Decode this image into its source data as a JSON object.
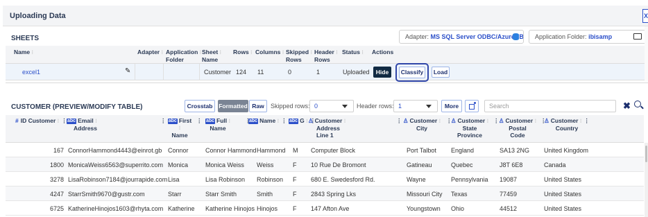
{
  "window": {
    "title": "Uploading Data",
    "close_label": "X"
  },
  "sheets": {
    "title": "SHEETS",
    "adapter": {
      "label": "Adapter:",
      "value": "MS SQL Server ODBC/AzureDB -..."
    },
    "app_folder": {
      "label": "Application Folder:",
      "value": "ibisamp"
    },
    "columns": [
      {
        "l1": "Name",
        "l2": ""
      },
      {
        "l1": "Adapter",
        "l2": ""
      },
      {
        "l1": "Application",
        "l2": "Folder"
      },
      {
        "l1": "Sheet",
        "l2": "Name"
      },
      {
        "l1": "Rows",
        "l2": ""
      },
      {
        "l1": "Columns",
        "l2": ""
      },
      {
        "l1": "Skipped",
        "l2": "Rows"
      },
      {
        "l1": "Header",
        "l2": "Rows"
      },
      {
        "l1": "Status",
        "l2": ""
      },
      {
        "l1": "Actions",
        "l2": ""
      }
    ],
    "row": {
      "name": "excel1",
      "sheet_name": "Customer",
      "rows": "124",
      "columns": "11",
      "skipped_rows": "0",
      "header_rows": "1",
      "status": "Uploaded",
      "actions": {
        "hide": "Hide",
        "classify": "Classify",
        "load": "Load"
      }
    }
  },
  "preview": {
    "title": "CUSTOMER (PREVIEW/MODIFY TABLE)",
    "buttons": {
      "crosstab": "Crosstab",
      "formatted": "Formatted",
      "raw": "Raw",
      "more": "More"
    },
    "skipped_rows": {
      "label": "Skipped rows:",
      "value": "0"
    },
    "header_rows": {
      "label": "Header rows:",
      "value": "1"
    },
    "search": {
      "placeholder": "Search"
    },
    "columns": [
      {
        "l1": "ID Customer",
        "l2": "",
        "l3": ""
      },
      {
        "l1": "Email",
        "l2": "Address",
        "l3": ""
      },
      {
        "l1": "First",
        "l2": "Name",
        "l3": ""
      },
      {
        "l1": "Full",
        "l2": "Name",
        "l3": ""
      },
      {
        "l1": "Name",
        "l2": "",
        "l3": ""
      },
      {
        "l1": "G",
        "l2": "",
        "l3": ""
      },
      {
        "l1": "Customer",
        "l2": "Address",
        "l3": "Line 1"
      },
      {
        "l1": "Customer",
        "l2": "City",
        "l3": ""
      },
      {
        "l1": "Customer",
        "l2": "State",
        "l3": "Province"
      },
      {
        "l1": "Customer",
        "l2": "Postal",
        "l3": "Code"
      },
      {
        "l1": "Customer",
        "l2": "Country",
        "l3": ""
      }
    ],
    "rows": [
      [
        "167",
        "ConnorHammond4443@einrot.gb",
        "Connor",
        "Connor Hammond",
        "Hammond",
        "M",
        "Computer Block",
        "Port Talbot",
        "England",
        "SA13 2NG",
        "United Kingdom"
      ],
      [
        "1800",
        "MonicaWeiss6563@superrito.com",
        "Monica",
        "Monica Weiss",
        "Weiss",
        "F",
        "10 Rue De Bromont",
        "Gatineau",
        "Quebec",
        "J8T 6E8",
        "Canada"
      ],
      [
        "3278",
        "LisaRobinson7184@jourrapide.com",
        "Lisa",
        "Lisa Robinson",
        "Robinson",
        "F",
        "680 E. Swedesford Rd.",
        "Wayne",
        "Pennsylvania",
        "19087",
        "United States"
      ],
      [
        "4247",
        "StarrSmith9670@gustr.com",
        "Starr",
        "Starr Smith",
        "Smith",
        "F",
        "2843 Spring Lks",
        "Missouri City",
        "Texas",
        "77459",
        "United States"
      ],
      [
        "6725",
        "KatherineHinojos1603@rhyta.com",
        "Katherine",
        "Katherine Hinojos",
        "Hinojos",
        "F",
        "147 Afton Ave",
        "Youngstown",
        "Ohio",
        "44512",
        "United States"
      ]
    ]
  }
}
